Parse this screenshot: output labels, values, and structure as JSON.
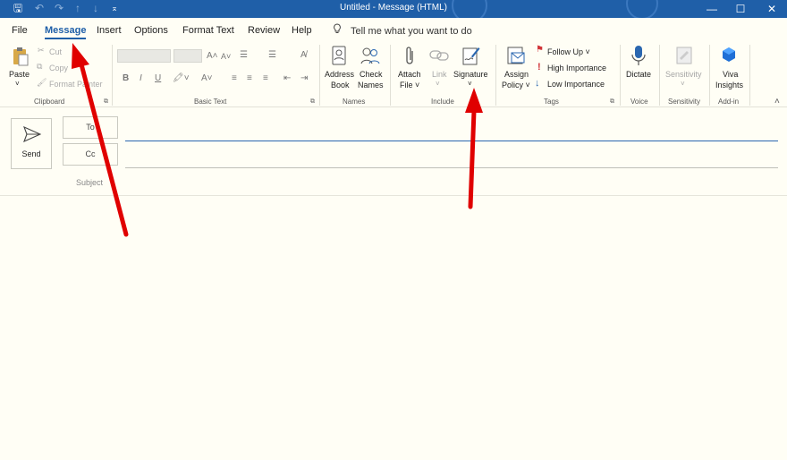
{
  "window": {
    "title": "Untitled - Message (HTML)",
    "controls": {
      "minimize": "—",
      "restore": "☐",
      "close": "✕"
    }
  },
  "quick_access": {
    "save_icon": "save-icon",
    "undo_icon": "undo-icon",
    "redo_icon": "redo-icon",
    "up_icon": "up-arrow-icon",
    "down_icon": "down-arrow-icon",
    "customize_icon": "customize-icon"
  },
  "tabs": [
    "File",
    "Message",
    "Insert",
    "Options",
    "Format Text",
    "Review",
    "Help"
  ],
  "active_tab": "Message",
  "tell_me": "Tell me what you want to do",
  "ribbon": {
    "clipboard": {
      "paste": "Paste",
      "cut": "Cut",
      "copy": "Copy",
      "format_painter": "Format Painter",
      "label": "Clipboard"
    },
    "basic_text": {
      "label": "Basic Text"
    },
    "names": {
      "address_book_1": "Address",
      "address_book_2": "Book",
      "check_names_1": "Check",
      "check_names_2": "Names",
      "label": "Names"
    },
    "include": {
      "attach_1": "Attach",
      "attach_2": "File ˅",
      "link": "Link",
      "signature": "Signature",
      "label": "Include"
    },
    "tags": {
      "assign_1": "Assign",
      "assign_2": "Policy ˅",
      "follow_up": "Follow Up ˅",
      "high_importance": "High Importance",
      "low_importance": "Low Importance",
      "label": "Tags"
    },
    "voice": {
      "dictate": "Dictate",
      "label": "Voice"
    },
    "sensitivity": {
      "button": "Sensitivity",
      "label": "Sensitivity"
    },
    "addin": {
      "viva_1": "Viva",
      "viva_2": "Insights",
      "label": "Add-in"
    }
  },
  "compose": {
    "send": "Send",
    "to": "To",
    "cc": "Cc",
    "subject": "Subject"
  },
  "colors": {
    "accent": "#1f5fa8",
    "annotation": "#e00000",
    "flag": "#d13438",
    "link_blue": "#2b67b0"
  }
}
